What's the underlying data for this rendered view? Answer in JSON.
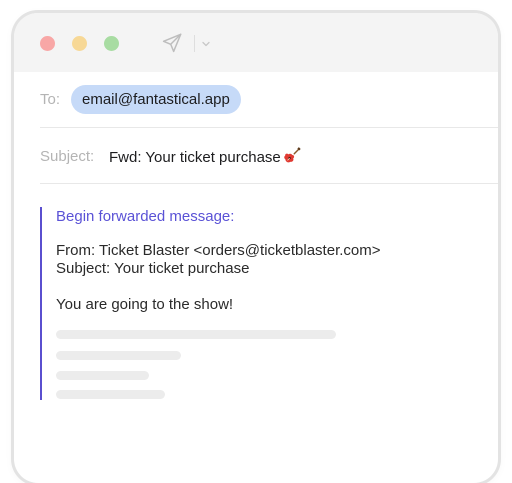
{
  "icons": {
    "send": "paper-plane-icon",
    "more": "chevron-down-icon",
    "subject_emoji": "guitar-icon"
  },
  "colors": {
    "close_light": "#f8a7a6",
    "minimize_light": "#f7d896",
    "zoom_light": "#a8dca2",
    "chip_bg": "#c6daf8",
    "quote_bar": "#5a4fcf",
    "forward_heading": "#5a52d6"
  },
  "compose": {
    "to_label": "To:",
    "to_recipient": "email@fantastical.app",
    "subject_label": "Subject:",
    "subject_value": "Fwd: Your ticket purchase"
  },
  "forwarded": {
    "heading": "Begin forwarded message:",
    "from_line": "From: Ticket Blaster <orders@ticketblaster.com>",
    "subject_line": "Subject: Your ticket purchase",
    "body": "You are going to the show!"
  }
}
